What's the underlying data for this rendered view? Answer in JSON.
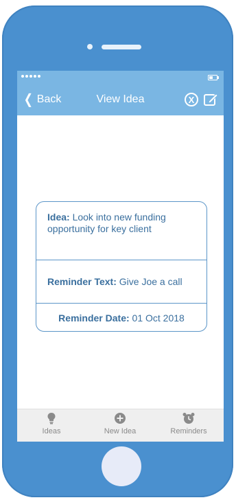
{
  "nav": {
    "back_label": "Back",
    "title": "View Idea",
    "close_label": "X"
  },
  "idea": {
    "idea_label": "Idea:",
    "idea_text": "Look into new funding opportunity for key client",
    "reminder_text_label": "Reminder Text:",
    "reminder_text": "Give Joe a call",
    "reminder_date_label": "Reminder Date:",
    "reminder_date": "01 Oct 2018"
  },
  "tabs": [
    {
      "label": "Ideas",
      "icon": "lightbulb-icon"
    },
    {
      "label": "New Idea",
      "icon": "plus-circle-icon"
    },
    {
      "label": "Reminders",
      "icon": "alarm-clock-icon"
    }
  ],
  "colors": {
    "phone_body": "#4a90cf",
    "header": "#7ab6e3",
    "card_text": "#3a6f9e",
    "tab_icon": "#8a8a8a"
  }
}
